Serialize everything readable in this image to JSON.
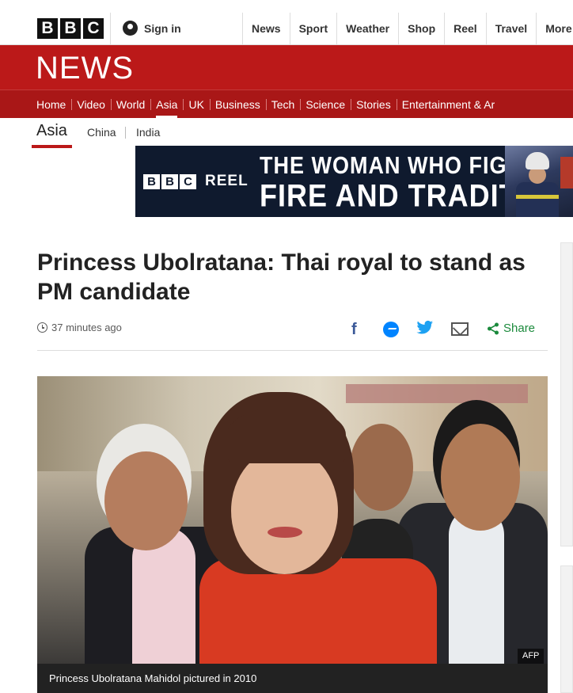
{
  "brand": {
    "letters": [
      "B",
      "B",
      "C"
    ],
    "news_word": "NEWS"
  },
  "topbar": {
    "signin_label": "Sign in",
    "links": [
      "News",
      "Sport",
      "Weather",
      "Shop",
      "Reel",
      "Travel",
      "More"
    ]
  },
  "sections": [
    "Home",
    "Video",
    "World",
    "Asia",
    "UK",
    "Business",
    "Tech",
    "Science",
    "Stories",
    "Entertainment & Ar"
  ],
  "active_section": "Asia",
  "subnav": {
    "current": "Asia",
    "links": [
      "China",
      "India"
    ]
  },
  "ad": {
    "logo_letters": [
      "B",
      "B",
      "C"
    ],
    "reel": "REEL",
    "line1": "THE WOMAN WHO FIGHTS",
    "line2": "FIRE AND TRADITION"
  },
  "article": {
    "headline": "Princess Ubolratana: Thai royal to stand as PM candidate",
    "timestamp": "37 minutes ago",
    "share_label": "Share",
    "image_credit": "AFP",
    "caption": "Princess Ubolratana Mahidol pictured in 2010"
  },
  "colors": {
    "news_red": "#bb1919",
    "nav_red": "#a91717",
    "share_green": "#1b8a3c"
  }
}
